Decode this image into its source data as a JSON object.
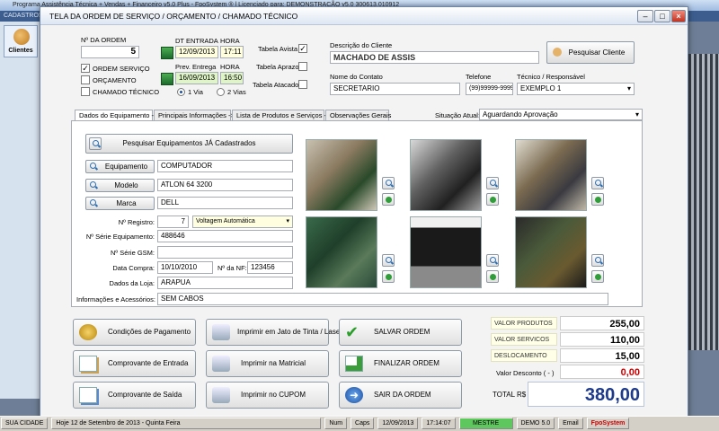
{
  "background": {
    "title": "Programa Assistência Técnica + Vendas + Financeiro v5.0 Plus - FpoSystem ® | Licenciado para: DEMONSTRAÇÃO v5.0 300613.010912",
    "menu": "CADASTROS",
    "sidebar_clientes": "Clientes",
    "sidebar_tab": "Pe"
  },
  "status_bar": [
    "SUA CIDADE",
    "Hoje 12 de Setembro de 2013 - Quinta Feira",
    "Num",
    "Caps",
    "12/09/2013",
    "17:14:07",
    "MESTRE",
    "DEMO 5.0",
    "Email",
    "FpoSystem"
  ],
  "dialog": {
    "title": "TELA DA ORDEM DE SERVIÇO / ORÇAMENTO / CHAMADO TÉCNICO",
    "ordem_label": "Nº DA ORDEM",
    "ordem_value": "5",
    "tipo_ordem_servico": "ORDEM SERVIÇO",
    "tipo_orcamento": "ORÇAMENTO",
    "tipo_chamado": "CHAMADO TÉCNICO",
    "dt_entrada_label": "DT ENTRADA",
    "dt_entrada_value": "12/09/2013",
    "hora_label": "HORA",
    "hora_entrada_value": "17:11",
    "prev_entrega_label": "Prev. Entrega",
    "prev_entrega_value": "16/09/2013",
    "hora_entrega_value": "16:50",
    "via1": "1 Via",
    "via2": "2 Vias",
    "tabela_avista": "Tabela Avista",
    "tabela_aprazo": "Tabela Aprazo",
    "tabela_atacado": "Tabela Atacado",
    "descricao_cliente_label": "Descrição do Cliente",
    "descricao_cliente_value": "MACHADO DE ASSIS",
    "pesquisar_cliente": "Pesquisar Cliente",
    "nome_contato_label": "Nome do Contato",
    "nome_contato_value": "SECRETARIO",
    "telefone_label": "Telefone",
    "telefone_value": "(99)99999-9999",
    "tecnico_label": "Técnico / Responsável",
    "tecnico_value": "EXEMPLO 1",
    "tabs": [
      "Dados do Equipamento ->",
      "Principais Informações ->",
      "Lista de Produtos e Serviços ->",
      "Observações Gerais"
    ],
    "situacao_label": "Situação Atual:",
    "situacao_value": "Aguardando Aprovação",
    "pesquisar_equip": "Pesquisar Equipamentos JÁ Cadastrados",
    "equipamento_btn": "Equipamento",
    "equipamento_value": "COMPUTADOR",
    "modelo_btn": "Modelo",
    "modelo_value": "ATLON 64 3200",
    "marca_btn": "Marca",
    "marca_value": "DELL",
    "registro_label": "Nº Registro:",
    "registro_value": "7",
    "voltagem_value": "Voltagem Automática",
    "serie_equip_label": "Nº Série Equipamento:",
    "serie_equip_value": "488646",
    "serie_gsm_label": "Nº Série GSM:",
    "serie_gsm_value": "",
    "data_compra_label": "Data Compra:",
    "data_compra_value": "10/10/2010",
    "nf_label": "Nº da NF:",
    "nf_value": "123456",
    "loja_label": "Dados da Loja:",
    "loja_value": "ARAPUA",
    "info_label": "Informações e Acessórios:",
    "info_value": "SEM CABOS"
  },
  "actions": {
    "condicoes": "Condições de Pagamento",
    "comp_entrada": "Comprovante de Entrada",
    "comp_saida": "Comprovante de Saída",
    "imp_jato": "Imprimir em Jato de Tinta / Laser",
    "imp_matricial": "Imprimir na Matricial",
    "imp_cupom": "Imprimir no CUPOM",
    "salvar": "SALVAR ORDEM",
    "finalizar": "FINALIZAR ORDEM",
    "sair": "SAIR DA ORDEM"
  },
  "totals": {
    "produtos_label": "VALOR PRODUTOS",
    "produtos_value": "255,00",
    "servicos_label": "VALOR SERVICOS",
    "servicos_value": "110,00",
    "deslocamento_label": "DESLOCAMENTO",
    "deslocamento_value": "15,00",
    "desconto_label": "Valor Desconto ( - )",
    "desconto_value": "0,00",
    "total_label": "TOTAL R$",
    "total_value": "380,00"
  },
  "colors": {
    "accent": "#1e3a8a",
    "desconto": "#cc0000",
    "titlebar": "#dde6f2"
  }
}
